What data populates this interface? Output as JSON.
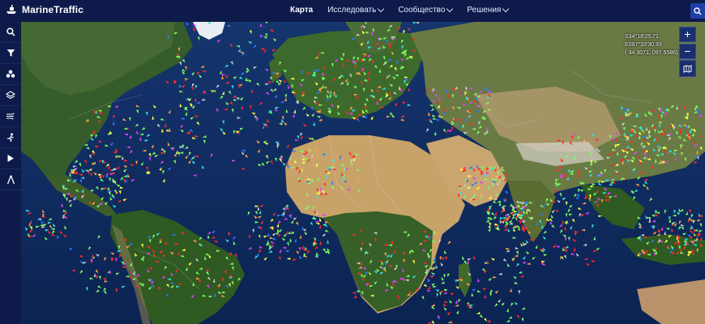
{
  "header": {
    "brand": "MarineTraffic",
    "nav": [
      {
        "label": "Карта",
        "active": true,
        "dropdown": false
      },
      {
        "label": "Исследовать",
        "active": false,
        "dropdown": true
      },
      {
        "label": "Сообщество",
        "active": false,
        "dropdown": true
      },
      {
        "label": "Решения",
        "active": false,
        "dropdown": true
      }
    ],
    "search_icon": "search-icon"
  },
  "sidebar": {
    "items": [
      {
        "icon": "search-icon"
      },
      {
        "icon": "filter-icon"
      },
      {
        "icon": "clusters-icon"
      },
      {
        "icon": "layers-icon"
      },
      {
        "icon": "weather-icon"
      },
      {
        "icon": "routes-icon"
      },
      {
        "icon": "playback-icon"
      },
      {
        "icon": "measure-icon"
      }
    ]
  },
  "map": {
    "coordinates": {
      "lat_dms": "S34°18'25.71",
      "lon_dms": "E097°33'30.93",
      "decimal": "(-34.3071, 097.5586)"
    },
    "zoom_in": "+",
    "zoom_out": "−",
    "layers_icon": "map-layers-icon",
    "colors": {
      "cargo": "#7CFC64",
      "tanker": "#ff2a2a",
      "passenger": "#2a7bff",
      "fishing": "#ffa04a",
      "tug": "#38e0e0",
      "pleasure": "#e040fb",
      "highspeed": "#ffff44",
      "unknown": "#cccccc"
    }
  }
}
